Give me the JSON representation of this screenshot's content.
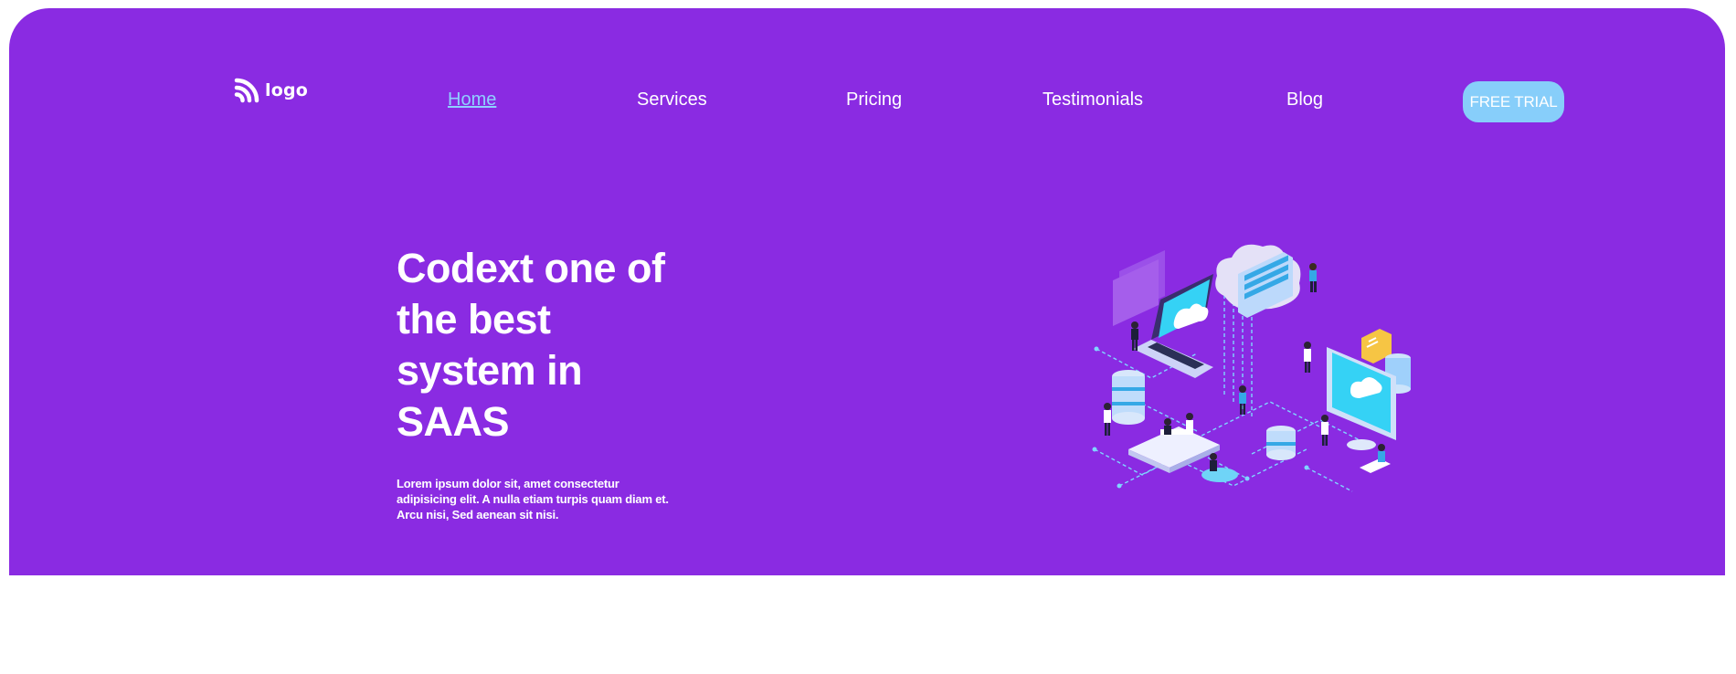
{
  "brand": {
    "logo_text": "logo",
    "logo_icon": "rss-icon"
  },
  "nav": {
    "items": [
      {
        "label": "Home",
        "active": true
      },
      {
        "label": "Services",
        "active": false
      },
      {
        "label": "Pricing",
        "active": false
      },
      {
        "label": "Testimonials",
        "active": false
      },
      {
        "label": "Blog",
        "active": false
      }
    ],
    "cta_label": "FREE TRIAL"
  },
  "hero": {
    "headline": "Codext one of the best system in SAAS",
    "description": "Lorem ipsum dolor sit, amet consectetur adipisicing elit. A nulla etiam turpis quam diam et. Arcu nisi, Sed aenean sit nisi.",
    "illustration": "isometric-cloud-network-illustration"
  },
  "colors": {
    "hero_background": "#8a2be2",
    "cta_background": "#87cefa",
    "active_link": "#8fd0ff",
    "text": "#ffffff"
  }
}
